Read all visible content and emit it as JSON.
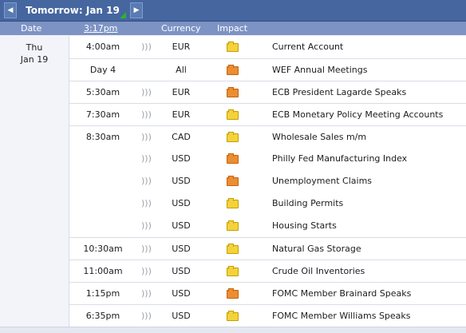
{
  "nav": {
    "title": "Tomorrow: Jan 19",
    "prev_arrow": "◀",
    "next_arrow": "▶"
  },
  "columns": {
    "date": "Date",
    "time": "3:17pm",
    "currency": "Currency",
    "impact": "Impact"
  },
  "date_cell": {
    "weekday": "Thu",
    "day": "Jan 19"
  },
  "sound_glyph": ")))",
  "impact_colors": {
    "low": "#f4d23c",
    "medium": "#ec8d31"
  },
  "events": [
    {
      "time": "4:00am",
      "sound": true,
      "currency": "EUR",
      "impact": "low",
      "event": "Current Account"
    },
    {
      "time": "Day 4",
      "sound": false,
      "currency": "All",
      "impact": "medium",
      "event": "WEF Annual Meetings"
    },
    {
      "time": "5:30am",
      "sound": true,
      "currency": "EUR",
      "impact": "medium",
      "event": "ECB President Lagarde Speaks"
    },
    {
      "time": "7:30am",
      "sound": true,
      "currency": "EUR",
      "impact": "low",
      "event": "ECB Monetary Policy Meeting Accounts"
    },
    {
      "time": "8:30am",
      "sound": true,
      "currency": "CAD",
      "impact": "low",
      "event": "Wholesale Sales m/m"
    },
    {
      "time": "",
      "sound": true,
      "currency": "USD",
      "impact": "medium",
      "event": "Philly Fed Manufacturing Index"
    },
    {
      "time": "",
      "sound": true,
      "currency": "USD",
      "impact": "medium",
      "event": "Unemployment Claims"
    },
    {
      "time": "",
      "sound": true,
      "currency": "USD",
      "impact": "low",
      "event": "Building Permits"
    },
    {
      "time": "",
      "sound": true,
      "currency": "USD",
      "impact": "low",
      "event": "Housing Starts"
    },
    {
      "time": "10:30am",
      "sound": true,
      "currency": "USD",
      "impact": "low",
      "event": "Natural Gas Storage"
    },
    {
      "time": "11:00am",
      "sound": true,
      "currency": "USD",
      "impact": "low",
      "event": "Crude Oil Inventories"
    },
    {
      "time": "1:15pm",
      "sound": true,
      "currency": "USD",
      "impact": "medium",
      "event": "FOMC Member Brainard Speaks"
    },
    {
      "time": "6:35pm",
      "sound": true,
      "currency": "USD",
      "impact": "low",
      "event": "FOMC Member Williams Speaks"
    }
  ]
}
